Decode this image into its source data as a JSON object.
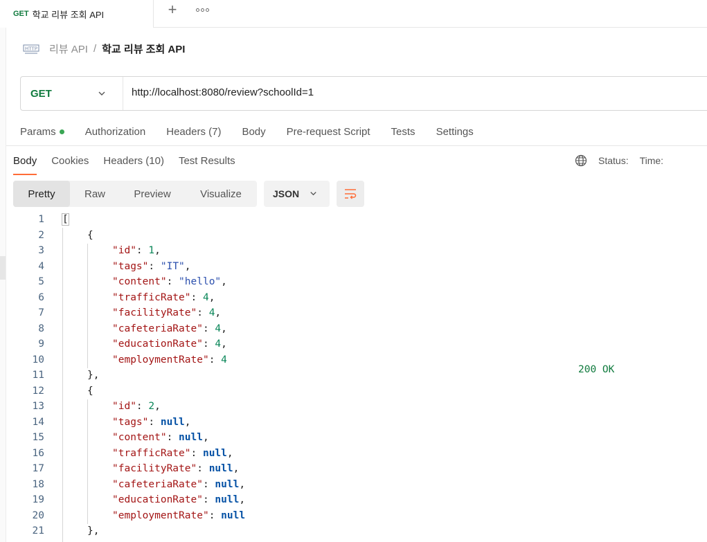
{
  "tab": {
    "method": "GET",
    "title": "학교 리뷰 조회 API",
    "add_symbol": "+"
  },
  "breadcrumb": {
    "parent": "리뷰 API",
    "separator": "/",
    "current": "학교 리뷰 조회 API",
    "icon": "http-icon"
  },
  "request": {
    "method": "GET",
    "url": "http://localhost:8080/review?schoolId=1"
  },
  "request_tabs": [
    {
      "label": "Params",
      "has_dot": true
    },
    {
      "label": "Authorization"
    },
    {
      "label": "Headers (7)"
    },
    {
      "label": "Body"
    },
    {
      "label": "Pre-request Script"
    },
    {
      "label": "Tests"
    },
    {
      "label": "Settings"
    }
  ],
  "response_tabs": [
    {
      "label": "Body",
      "active": true
    },
    {
      "label": "Cookies"
    },
    {
      "label": "Headers (10)"
    },
    {
      "label": "Test Results"
    }
  ],
  "status": {
    "label": "Status:",
    "code": "200 OK",
    "time_label": "Time:"
  },
  "view_modes": [
    "Pretty",
    "Raw",
    "Preview",
    "Visualize"
  ],
  "format": "JSON",
  "colors": {
    "accent": "#ff6c37",
    "method_get": "#0f7a3d",
    "key": "#a31515",
    "string": "#2b4fad",
    "number": "#098658",
    "null": "#0451a5"
  },
  "code_lines": [
    "1",
    "2",
    "3",
    "4",
    "5",
    "6",
    "7",
    "8",
    "9",
    "10",
    "11",
    "12",
    "13",
    "14",
    "15",
    "16",
    "17",
    "18",
    "19",
    "20",
    "21"
  ],
  "json": [
    {
      "id": "1",
      "tags": "\"IT\"",
      "content": "\"hello\"",
      "trafficRate": "4",
      "facilityRate": "4",
      "cafeteriaRate": "4",
      "educationRate": "4",
      "employmentRate": "4"
    },
    {
      "id": "2",
      "tags": "null",
      "content": "null",
      "trafficRate": "null",
      "facilityRate": "null",
      "cafeteriaRate": "null",
      "educationRate": "null",
      "employmentRate": "null"
    }
  ],
  "tokens": {
    "open_array": "[",
    "open_obj": "{",
    "close_obj_comma": "},",
    "k_id": "\"id\"",
    "k_tags": "\"tags\"",
    "k_content": "\"content\"",
    "k_trafficRate": "\"trafficRate\"",
    "k_facilityRate": "\"facilityRate\"",
    "k_cafeteriaRate": "\"cafeteriaRate\"",
    "k_educationRate": "\"educationRate\"",
    "k_employmentRate": "\"employmentRate\"",
    "colon": ": ",
    "comma": ","
  }
}
